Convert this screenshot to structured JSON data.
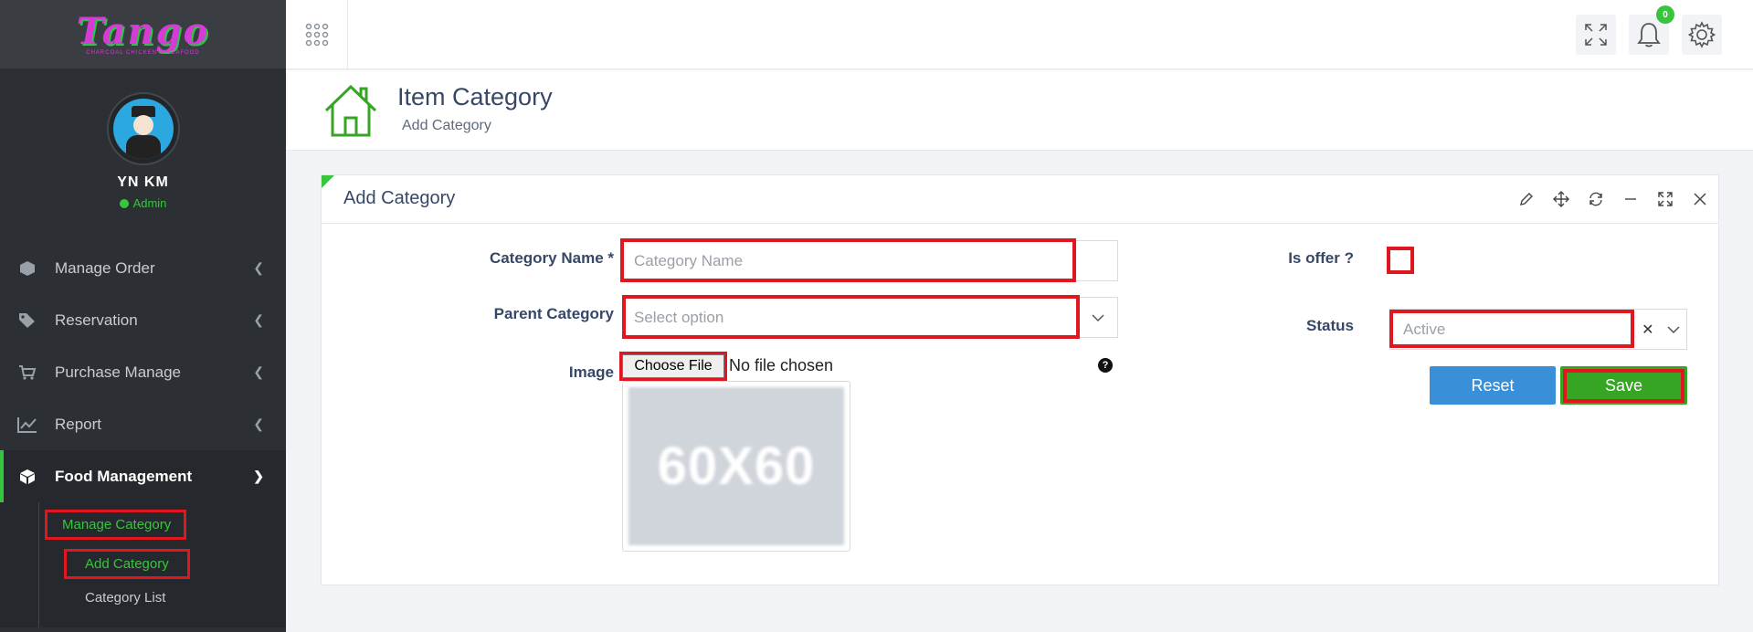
{
  "brand": {
    "logo_text": "Tango",
    "logo_sub": "CHARCOAL CHICKEN & SEAFOOD"
  },
  "user": {
    "name": "YN KM",
    "role": "Admin"
  },
  "sidebar": {
    "items": [
      {
        "label": "Manage Order",
        "icon": "box-icon"
      },
      {
        "label": "Reservation",
        "icon": "tags-icon"
      },
      {
        "label": "Purchase Manage",
        "icon": "cart-icon"
      },
      {
        "label": "Report",
        "icon": "chart-line-icon"
      },
      {
        "label": "Food Management",
        "icon": "cube-icon"
      }
    ],
    "submenu": {
      "parent": "Manage Category",
      "children": [
        "Add Category",
        "Category List"
      ]
    }
  },
  "topbar": {
    "notification_count": "0"
  },
  "page_header": {
    "title": "Item Category",
    "subtitle": "Add Category"
  },
  "panel": {
    "title": "Add Category",
    "form": {
      "category_name_label": "Category Name *",
      "category_name_placeholder": "Category Name",
      "parent_category_label": "Parent Category",
      "parent_category_placeholder": "Select option",
      "image_label": "Image",
      "file_button": "Choose File",
      "file_status": "No file chosen",
      "image_placeholder": "60X60",
      "is_offer_label": "Is offer ?",
      "status_label": "Status",
      "status_value": "Active",
      "reset_label": "Reset",
      "save_label": "Save"
    }
  },
  "colors": {
    "accent": "#37c53e",
    "sidebar_bg": "#2c2f33",
    "reset": "#3a8fd9",
    "save": "#37a524",
    "highlight": "#e0171f"
  }
}
